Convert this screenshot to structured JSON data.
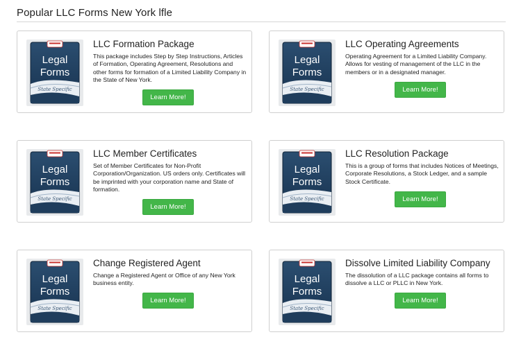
{
  "page": {
    "title": "Popular LLC Forms New York lfle"
  },
  "thumbnail": {
    "line1": "Legal",
    "line2": "Forms",
    "line3": "State Specific"
  },
  "colors": {
    "button": "#43b649",
    "thumb_navy": "#1f3d5c",
    "border": "#cfcfcf"
  },
  "cards": [
    {
      "title": "LLC Formation Package",
      "description": "This package includes Step by Step Instructions, Articles of Formation, Operating Agreement, Resolutions and other forms for formation of a Limited Liability Company in the State of New York.",
      "button": "Learn More!"
    },
    {
      "title": "LLC Operating Agreements",
      "description": "Operating Agreement for a Limited Liability Company. Allows for vesting of management of the LLC in the members or in a designated manager.",
      "button": "Learn More!"
    },
    {
      "title": "LLC Member Certificates",
      "description": "Set of Member Certificates for Non-Profit Corporation/Organization. US orders only. Certificates will be imprinted with your corporation name and State of formation.",
      "button": "Learn More!"
    },
    {
      "title": "LLC Resolution Package",
      "description": "This is a group of forms that includes Notices of Meetings, Corporate Resolutions, a Stock Ledger, and a sample Stock Certificate.",
      "button": "Learn More!"
    },
    {
      "title": "Change Registered Agent",
      "description": "Change a Registered Agent or Office of any New York business entity.",
      "button": "Learn More!"
    },
    {
      "title": "Dissolve Limited Liability Company",
      "description": "The dissolution of a LLC package contains all forms to dissolve a LLC or PLLC in New York.",
      "button": "Learn More!"
    }
  ]
}
